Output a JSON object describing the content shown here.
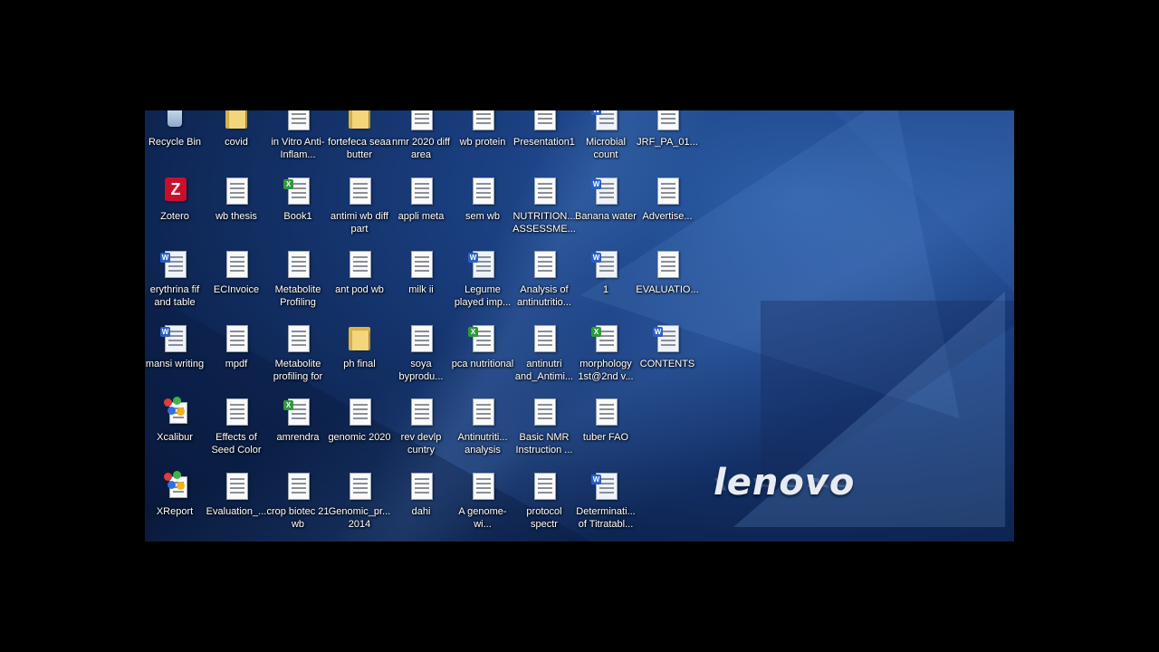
{
  "desktop": {
    "columns": [
      [
        {
          "label": "Recycle Bin",
          "icon": "recycle-bin-icon"
        },
        {
          "label": "Zotero",
          "icon": "zotero-icon"
        },
        {
          "label": "erythrina fif and table",
          "icon": "word-document-icon"
        },
        {
          "label": "mansi writing",
          "icon": "word-document-icon"
        },
        {
          "label": "Xcalibur",
          "icon": "xcalibur-icon"
        },
        {
          "label": "XReport",
          "icon": "xreport-icon"
        }
      ],
      [
        {
          "label": "covid",
          "icon": "folder-icon"
        },
        {
          "label": "wb thesis",
          "icon": "document-icon"
        },
        {
          "label": "ECInvoice",
          "icon": "document-icon"
        },
        {
          "label": "mpdf",
          "icon": "document-icon"
        },
        {
          "label": "Effects of Seed Color",
          "icon": "document-icon"
        },
        {
          "label": "Evaluation_...",
          "icon": "document-icon"
        }
      ],
      [
        {
          "label": "in Vitro Anti-Inflam...",
          "icon": "document-icon"
        },
        {
          "label": "Book1",
          "icon": "excel-document-icon"
        },
        {
          "label": "Metabolite Profiling",
          "icon": "document-icon"
        },
        {
          "label": "Metabolite profiling for",
          "icon": "document-icon"
        },
        {
          "label": "amrendra",
          "icon": "excel-document-icon"
        },
        {
          "label": "crop biotec 21 wb",
          "icon": "document-icon"
        }
      ],
      [
        {
          "label": "fortefeca seaa butter",
          "icon": "folder-icon"
        },
        {
          "label": "antimi wb diff part",
          "icon": "document-icon"
        },
        {
          "label": "ant pod wb",
          "icon": "document-icon"
        },
        {
          "label": "ph final",
          "icon": "folder-icon"
        },
        {
          "label": "genomic 2020",
          "icon": "document-icon"
        },
        {
          "label": "Genomic_pr... 2014",
          "icon": "document-icon"
        }
      ],
      [
        {
          "label": "nmr 2020 diff area",
          "icon": "document-icon"
        },
        {
          "label": "appli meta",
          "icon": "document-icon"
        },
        {
          "label": "milk ii",
          "icon": "document-icon"
        },
        {
          "label": "soya byprodu...",
          "icon": "document-icon"
        },
        {
          "label": "rev devlp cuntry",
          "icon": "document-icon"
        },
        {
          "label": "dahi",
          "icon": "document-icon"
        }
      ],
      [
        {
          "label": "wb protein",
          "icon": "document-icon"
        },
        {
          "label": "sem wb",
          "icon": "document-icon"
        },
        {
          "label": "Legume played imp...",
          "icon": "word-document-icon"
        },
        {
          "label": "pca nutritional",
          "icon": "excel-document-icon"
        },
        {
          "label": "Antinutriti... analysis",
          "icon": "document-icon"
        },
        {
          "label": "A genome-wi...",
          "icon": "document-icon"
        }
      ],
      [
        {
          "label": "Presentation1",
          "icon": "document-icon"
        },
        {
          "label": "NUTRITION... ASSESSME...",
          "icon": "document-icon"
        },
        {
          "label": "Analysis of antinutritio...",
          "icon": "document-icon"
        },
        {
          "label": "antinutri and_Antimi...",
          "icon": "document-icon"
        },
        {
          "label": "Basic NMR Instruction ...",
          "icon": "document-icon"
        },
        {
          "label": "protocol spectr",
          "icon": "document-icon"
        }
      ],
      [
        {
          "label": "Microbial count",
          "icon": "word-document-icon"
        },
        {
          "label": "Banana water",
          "icon": "word-document-icon"
        },
        {
          "label": "1",
          "icon": "word-document-icon"
        },
        {
          "label": "morphology 1st@2nd v...",
          "icon": "excel-document-icon"
        },
        {
          "label": "tuber FAO",
          "icon": "document-icon"
        },
        {
          "label": "Determinati... of Titratabl...",
          "icon": "word-document-icon"
        }
      ],
      [
        {
          "label": "JRF_PA_01...",
          "icon": "document-icon"
        },
        {
          "label": "Advertise...",
          "icon": "document-icon"
        },
        {
          "label": "EVALUATIO...",
          "icon": "document-icon"
        },
        {
          "label": "CONTENTS",
          "icon": "word-document-icon"
        }
      ]
    ]
  },
  "wallpaper": {
    "brand": "lenovo",
    "base_color": "#1a3f80",
    "accent_color": "#2d5fa8"
  }
}
